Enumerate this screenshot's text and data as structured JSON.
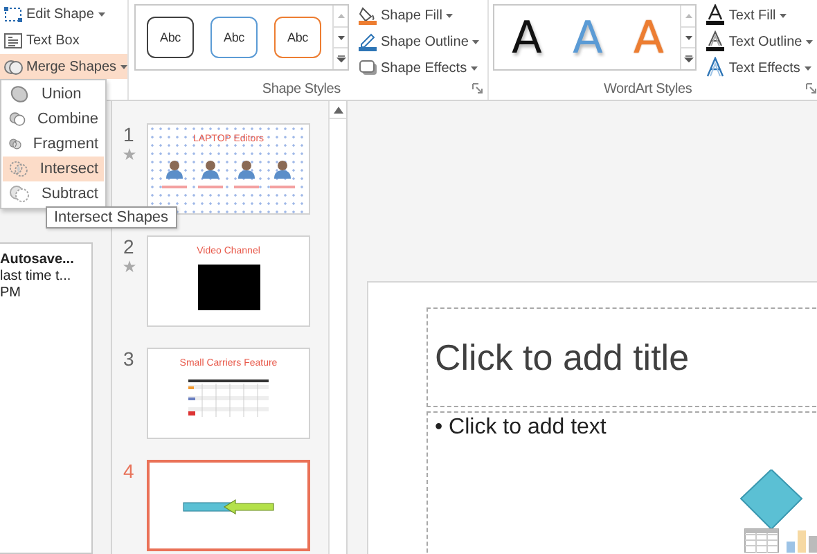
{
  "ribbon": {
    "shape_commands": [
      {
        "label": "Edit Shape",
        "dropdown": true,
        "active": false
      },
      {
        "label": "Text Box",
        "dropdown": false,
        "active": false
      },
      {
        "label": "Merge Shapes",
        "dropdown": true,
        "active": true
      }
    ],
    "shape_styles": {
      "samples": [
        {
          "label": "Abc",
          "color": "#404040"
        },
        {
          "label": "Abc",
          "color": "#5b9bd5"
        },
        {
          "label": "Abc",
          "color": "#ed7d31"
        }
      ],
      "commands": [
        {
          "label": "Shape Fill"
        },
        {
          "label": "Shape Outline"
        },
        {
          "label": "Shape Effects"
        }
      ],
      "group_label": "Shape Styles"
    },
    "wordart_styles": {
      "samples": [
        {
          "label": "A",
          "kind": "fill",
          "color": "#111111"
        },
        {
          "label": "A",
          "kind": "fill",
          "color": "#5b9bd5"
        },
        {
          "label": "A",
          "kind": "outline",
          "color": "#ed7d31"
        }
      ],
      "commands": [
        {
          "label": "Text Fill"
        },
        {
          "label": "Text Outline"
        },
        {
          "label": "Text Effects"
        }
      ],
      "group_label": "WordArt Styles"
    }
  },
  "merge_menu": {
    "items": [
      {
        "label": "Union",
        "selected": false
      },
      {
        "label": "Combine",
        "selected": false
      },
      {
        "label": "Fragment",
        "selected": false
      },
      {
        "label": "Intersect",
        "selected": true
      },
      {
        "label": "Subtract",
        "selected": false
      }
    ]
  },
  "tooltip": "Intersect Shapes",
  "autosave": {
    "title": "Autosave...",
    "lines": [
      "last time t...",
      "PM"
    ]
  },
  "slides": [
    {
      "number": "1",
      "title": "LAPTOP Editors",
      "kind": "people",
      "starred": true,
      "selected": false
    },
    {
      "number": "2",
      "title": "Video Channel",
      "kind": "video",
      "starred": true,
      "selected": false
    },
    {
      "number": "3",
      "title": "Small Carriers Feature",
      "kind": "table",
      "starred": false,
      "selected": false
    },
    {
      "number": "4",
      "kind": "arrows",
      "starred": false,
      "selected": true
    }
  ],
  "editor": {
    "title_placeholder": "Click to add title",
    "body_placeholder": "• Click to add text"
  }
}
